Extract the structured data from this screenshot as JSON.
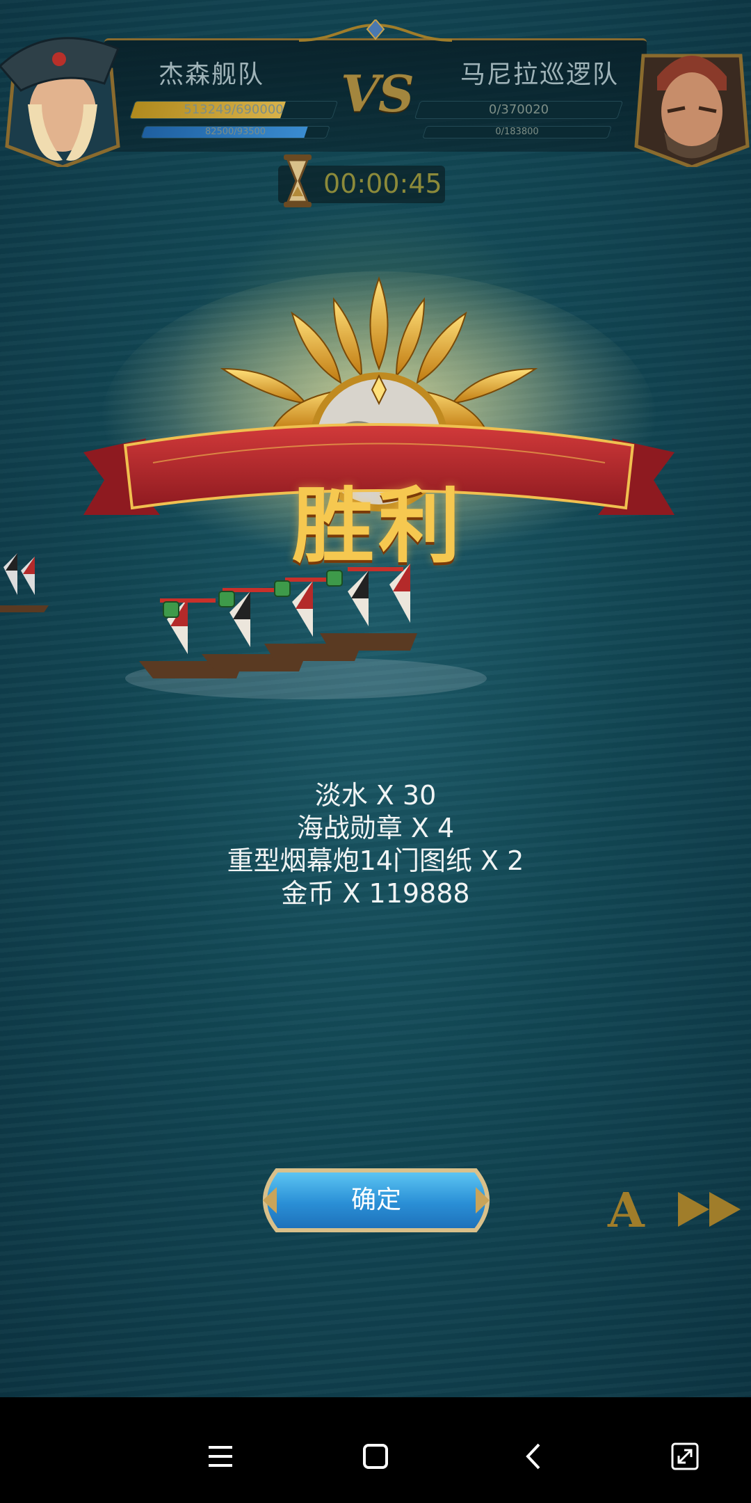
{
  "header": {
    "left_team": "杰森舰队",
    "right_team": "马尼拉巡逻队",
    "vs": "VS",
    "left_hp": "513249/690000",
    "left_hp_fraction": 0.744,
    "left_sub": "82500/93500",
    "left_sub_fraction": 0.882,
    "right_hp": "0/370020",
    "right_hp_fraction": 0,
    "right_sub": "0/183800",
    "right_sub_fraction": 0
  },
  "timer": "00:00:45",
  "victory_title": "胜利",
  "rewards": [
    "淡水 X 30",
    "海战勋章 X 4",
    "重型烟幕炮14门图纸 X 2",
    "金币 X 119888"
  ],
  "confirm_label": "确定",
  "auto_label": "A",
  "colors": {
    "gold": "#f6c850",
    "ribbon": "#b3232b",
    "button_blue": "#2a9ee0",
    "sea": "#124754"
  },
  "icons": {
    "auto": "auto-battle-icon",
    "fast_forward": "fast-forward-icon",
    "nav_menu": "menu-icon",
    "nav_home": "home-icon",
    "nav_back": "back-icon",
    "nav_rotate": "rotate-icon"
  }
}
